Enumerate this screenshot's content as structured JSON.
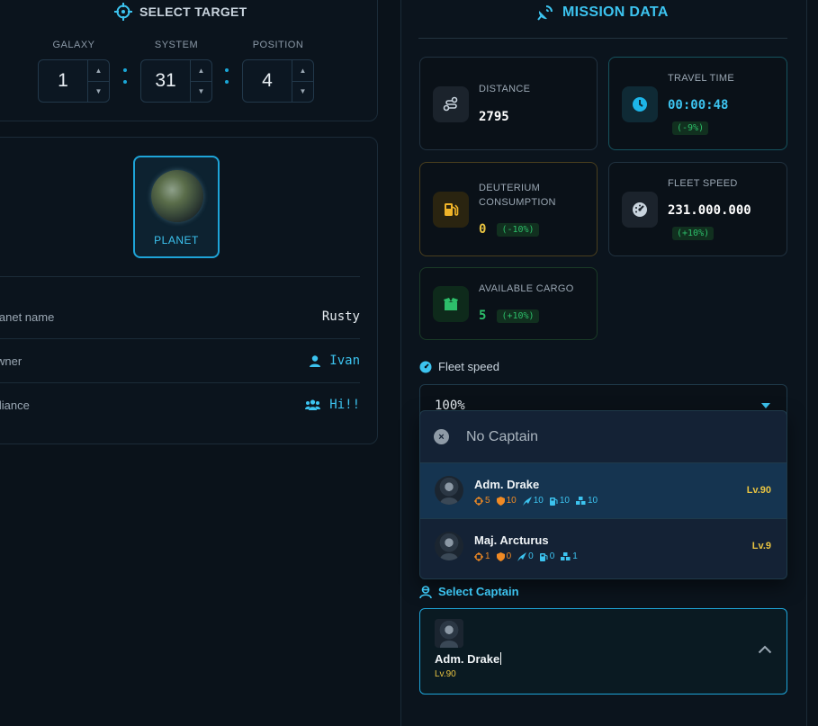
{
  "target": {
    "title": "SELECT TARGET",
    "galaxy_label": "GALAXY",
    "system_label": "SYSTEM",
    "position_label": "POSITION",
    "galaxy": "1",
    "system": "31",
    "position": "4",
    "up_arrow": "▲",
    "down_arrow": "▼"
  },
  "planet": {
    "type_label": "PLANET",
    "rows": [
      {
        "key": "lanet name",
        "value": "Rusty"
      },
      {
        "key": "wner",
        "value": "Ivan"
      },
      {
        "key": "lliance",
        "value": "Hi!!"
      }
    ]
  },
  "mission": {
    "title": "MISSION DATA",
    "distance": {
      "label": "DISTANCE",
      "value": "2795"
    },
    "travel_time": {
      "label": "TRAVEL TIME",
      "value": "00:00:48",
      "modifier": "(-9%)"
    },
    "deuterium": {
      "label_line1": "DEUTERIUM",
      "label_line2": "CONSUMPTION",
      "value": "0",
      "modifier": "(-10%)"
    },
    "fleet_speed": {
      "label": "FLEET SPEED",
      "value": "231.000.000",
      "modifier": "(+10%)"
    },
    "cargo": {
      "label": "AVAILABLE CARGO",
      "value": "5",
      "modifier": "(+10%)"
    }
  },
  "speed": {
    "label": "Fleet speed",
    "value": "100%"
  },
  "captains": {
    "none_label": "No Captain",
    "none_icon": "×",
    "items": [
      {
        "name": "Adm. Drake",
        "level": "Lv.90",
        "stats": [
          "5",
          "10",
          "10",
          "10",
          "10"
        ]
      },
      {
        "name": "Maj. Arcturus",
        "level": "Lv.9",
        "stats": [
          "1",
          "0",
          "0",
          "0",
          "1"
        ]
      }
    ],
    "select_label": "Select Captain",
    "selected_name": "Adm. Drake",
    "selected_level": "Lv.90"
  },
  "colors": {
    "accent": "#3cc3ef",
    "gold": "#e8c341",
    "green": "#2dbf6a",
    "orange": "#f08a24"
  }
}
